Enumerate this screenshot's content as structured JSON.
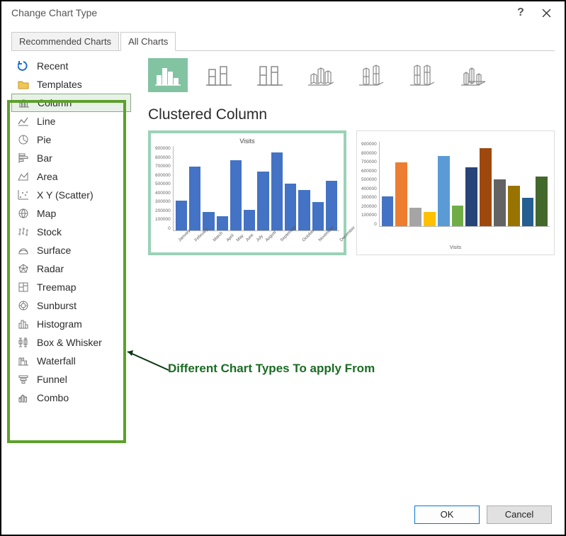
{
  "title": "Change Chart Type",
  "helpLabel": "?",
  "tabs": {
    "recommended": "Recommended Charts",
    "all": "All Charts"
  },
  "sidebar": {
    "items": [
      {
        "label": "Recent"
      },
      {
        "label": "Templates"
      },
      {
        "label": "Column"
      },
      {
        "label": "Line"
      },
      {
        "label": "Pie"
      },
      {
        "label": "Bar"
      },
      {
        "label": "Area"
      },
      {
        "label": "X Y (Scatter)"
      },
      {
        "label": "Map"
      },
      {
        "label": "Stock"
      },
      {
        "label": "Surface"
      },
      {
        "label": "Radar"
      },
      {
        "label": "Treemap"
      },
      {
        "label": "Sunburst"
      },
      {
        "label": "Histogram"
      },
      {
        "label": "Box & Whisker"
      },
      {
        "label": "Waterfall"
      },
      {
        "label": "Funnel"
      },
      {
        "label": "Combo"
      }
    ]
  },
  "sectionTitle": "Clustered Column",
  "annotation": "Different Chart Types To apply From",
  "buttons": {
    "ok": "OK",
    "cancel": "Cancel"
  },
  "chart_data": {
    "type": "bar",
    "title": "Visits",
    "xlabel": "",
    "ylabel": "",
    "ylim": [
      0,
      900000
    ],
    "yticks": [
      0,
      100000,
      200000,
      300000,
      400000,
      500000,
      600000,
      700000,
      800000,
      900000
    ],
    "categories": [
      "January",
      "February",
      "March",
      "April",
      "May",
      "June",
      "July",
      "August",
      "September",
      "October",
      "November",
      "December"
    ],
    "values": [
      320000,
      680000,
      200000,
      150000,
      750000,
      220000,
      630000,
      830000,
      500000,
      430000,
      300000,
      530000
    ],
    "preview2_xaxis_label": "Visits"
  }
}
